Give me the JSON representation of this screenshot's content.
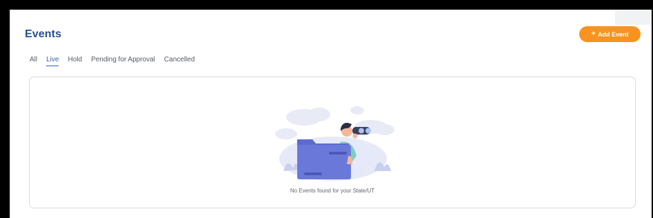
{
  "header": {
    "title": "Events",
    "add_button_label": "Add Event",
    "add_button_icon": "plus-icon"
  },
  "tabs": [
    {
      "label": "All",
      "active": false
    },
    {
      "label": "Live",
      "active": true
    },
    {
      "label": "Hold",
      "active": false
    },
    {
      "label": "Pending for Approval",
      "active": false
    },
    {
      "label": "Cancelled",
      "active": false
    }
  ],
  "empty_state": {
    "message": "No Events found for your State/UT",
    "illustration": "person-with-binoculars-behind-folder"
  },
  "colors": {
    "title": "#274f8f",
    "accent_orange": "#f7931e",
    "active_tab": "#2f62b3",
    "folder": "#6a79d9"
  }
}
